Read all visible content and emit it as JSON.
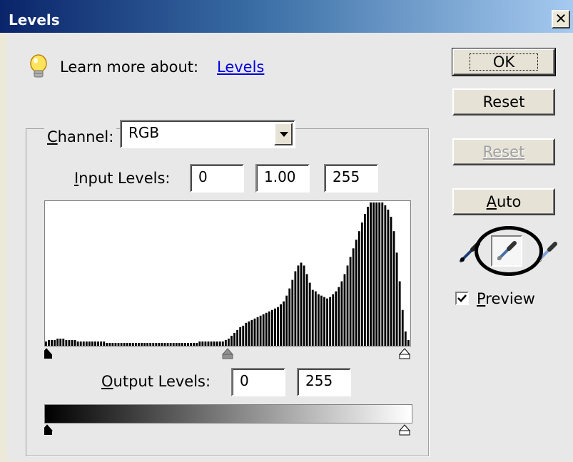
{
  "window": {
    "title": "Levels",
    "close_glyph": "✕"
  },
  "learn": {
    "icon": "lightbulb-icon",
    "label": "Learn more about:",
    "link": "Levels"
  },
  "channel": {
    "label_underlined": "C",
    "label_rest": "hannel:",
    "value": "RGB"
  },
  "input_levels": {
    "label_underlined": "I",
    "label_rest": "nput Levels:",
    "black": "0",
    "gamma": "1.00",
    "white": "255",
    "black_slider": 0,
    "gamma_slider": 1.0,
    "white_slider": 255
  },
  "output_levels": {
    "label_underlined": "O",
    "label_rest": "utput Levels:",
    "black": "0",
    "white": "255",
    "black_slider": 0,
    "white_slider": 255
  },
  "buttons": {
    "ok": "OK",
    "reset": "Reset",
    "reset_disabled": "Reset",
    "auto_underlined": "A",
    "auto_rest": "uto"
  },
  "eyedroppers": [
    "black-point-eyedropper-icon",
    "gray-point-eyedropper-icon",
    "white-point-eyedropper-icon"
  ],
  "eyedropper_selected": 1,
  "preview": {
    "checked": true,
    "label_underlined": "P",
    "label_rest": "review"
  },
  "histogram": {
    "bins": [
      3,
      4,
      4,
      4,
      5,
      5,
      5,
      4,
      4,
      4,
      4,
      3,
      3,
      3,
      3,
      3,
      3,
      3,
      3,
      3,
      3,
      2,
      2,
      2,
      2,
      2,
      2,
      2,
      2,
      2,
      2,
      2,
      2,
      2,
      2,
      2,
      2,
      2,
      2,
      2,
      2,
      2,
      2,
      2,
      2,
      2,
      2,
      2,
      2,
      2,
      2,
      2,
      2,
      3,
      3,
      3,
      3,
      3,
      3,
      3,
      3,
      3,
      4,
      5,
      7,
      9,
      11,
      13,
      14,
      16,
      17,
      18,
      19,
      20,
      21,
      22,
      23,
      24,
      25,
      26,
      27,
      29,
      31,
      35,
      40,
      46,
      52,
      56,
      58,
      56,
      50,
      44,
      39,
      38,
      36,
      35,
      34,
      33,
      34,
      36,
      38,
      41,
      45,
      50,
      56,
      62,
      68,
      74,
      80,
      86,
      92,
      97,
      100,
      100,
      100,
      100,
      100,
      98,
      95,
      90,
      80,
      65,
      45,
      25,
      10,
      4
    ],
    "colors": {
      "bars": "#000000",
      "background": "#ffffff"
    }
  },
  "annotations": {
    "circle_around": "gray-point-eyedropper"
  }
}
